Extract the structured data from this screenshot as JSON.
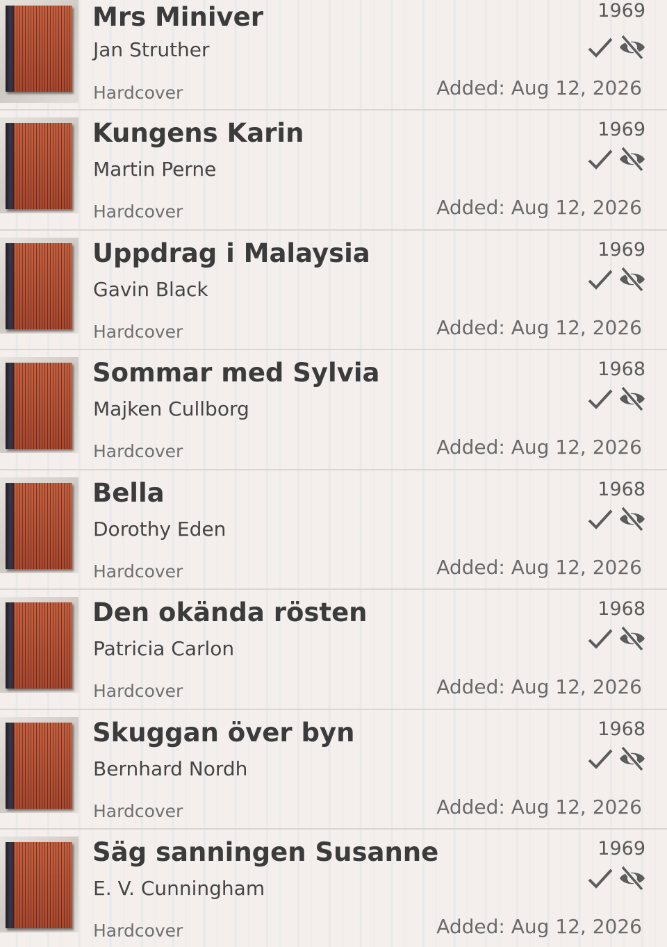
{
  "books": [
    {
      "title": "Mrs Miniver",
      "author": "Jan Struther",
      "format": "Hardcover",
      "year": "1969",
      "added": "Added: Aug 12, 2026"
    },
    {
      "title": "Kungens Karin",
      "author": "Martin Perne",
      "format": "Hardcover",
      "year": "1969",
      "added": "Added: Aug 12, 2026"
    },
    {
      "title": "Uppdrag i Malaysia",
      "author": "Gavin Black",
      "format": "Hardcover",
      "year": "1969",
      "added": "Added: Aug 12, 2026"
    },
    {
      "title": "Sommar med Sylvia",
      "author": "Majken Cullborg",
      "format": "Hardcover",
      "year": "1968",
      "added": "Added: Aug 12, 2026"
    },
    {
      "title": "Bella",
      "author": "Dorothy Eden",
      "format": "Hardcover",
      "year": "1968",
      "added": "Added: Aug 12, 2026"
    },
    {
      "title": "Den okända rösten",
      "author": "Patricia Carlon",
      "format": "Hardcover",
      "year": "1968",
      "added": "Added: Aug 12, 2026"
    },
    {
      "title": "Skuggan över byn",
      "author": "Bernhard Nordh",
      "format": "Hardcover",
      "year": "1968",
      "added": "Added: Aug 12, 2026"
    },
    {
      "title": "Säg sanningen Susanne",
      "author": "E. V. Cunningham",
      "format": "Hardcover",
      "year": "1969",
      "added": "Added: Aug 12, 2026"
    }
  ],
  "icons": {
    "status": "check-icon",
    "visibility": "eye-off-icon"
  },
  "colors": {
    "background": "#f4efec",
    "book_cover": "#b5543b",
    "text_primary": "#3b3b3b",
    "icon": "#5c5c5c"
  }
}
